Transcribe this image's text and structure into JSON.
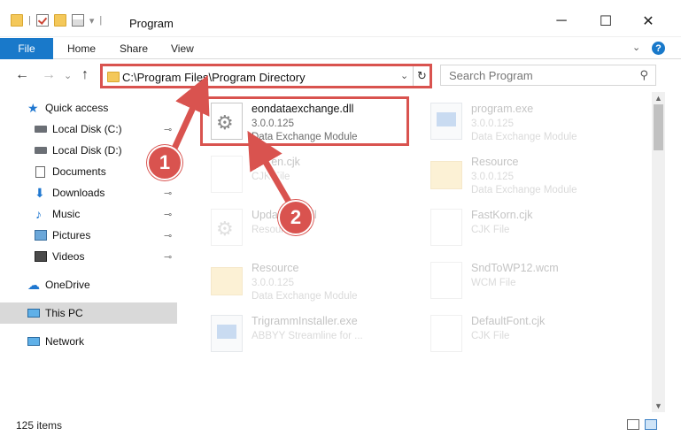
{
  "window": {
    "title": "Program",
    "minimize": "─",
    "maximize": "☐",
    "close": "✕"
  },
  "ribbon": {
    "file": "File",
    "home": "Home",
    "share": "Share",
    "view": "View",
    "collapse": "⌄",
    "help": "?"
  },
  "nav": {
    "back": "←",
    "forward": "→",
    "recent": "⌄",
    "up": "↑"
  },
  "address": {
    "path": "C:\\Program Files\\Program Directory",
    "dropdown": "⌄",
    "refresh": "↻"
  },
  "search": {
    "placeholder": "Search Program",
    "icon": "⚲"
  },
  "sidebar": {
    "items": [
      {
        "label": "Quick access",
        "icon": "star-icon",
        "pinned": false
      },
      {
        "label": "Local Disk (C:)",
        "icon": "disk-icon",
        "pinned": true
      },
      {
        "label": "Local Disk (D:)",
        "icon": "disk-icon",
        "pinned": true
      },
      {
        "label": "Documents",
        "icon": "document-icon",
        "pinned": true
      },
      {
        "label": "Downloads",
        "icon": "download-icon",
        "pinned": true
      },
      {
        "label": "Music",
        "icon": "music-icon",
        "pinned": true
      },
      {
        "label": "Pictures",
        "icon": "picture-icon",
        "pinned": true
      },
      {
        "label": "Videos",
        "icon": "video-icon",
        "pinned": true
      },
      {
        "label": "OneDrive",
        "icon": "cloud-icon",
        "pinned": false
      },
      {
        "label": "This PC",
        "icon": "pc-icon",
        "pinned": false,
        "selected": true
      },
      {
        "label": "Network",
        "icon": "network-icon",
        "pinned": false
      }
    ],
    "pin_glyph": "📌"
  },
  "files": [
    {
      "name": "eondataexchange.dll",
      "line1": "3.0.0.125",
      "line2": "Data Exchange Module",
      "icon": "gear-file-icon",
      "highlighted": true
    },
    {
      "name": "program.exe",
      "line1": "3.0.0.125",
      "line2": "Data Exchange Module",
      "icon": "exe-icon"
    },
    {
      "name": "Kr...en.cjk",
      "line1": "CJK File",
      "line2": "",
      "icon": "file-icon"
    },
    {
      "name": "Resource",
      "line1": "3.0.0.125",
      "line2": "Data Exchange Module",
      "icon": "folder-icon"
    },
    {
      "name": "Updat...19.dll",
      "line1": "Resour...",
      "line2": "",
      "icon": "gear-file-icon"
    },
    {
      "name": "FastKorn.cjk",
      "line1": "CJK File",
      "line2": "",
      "icon": "file-icon"
    },
    {
      "name": "Resource",
      "line1": "3.0.0.125",
      "line2": "Data Exchange Module",
      "icon": "folder-icon"
    },
    {
      "name": "SndToWP12.wcm",
      "line1": "WCM File",
      "line2": "",
      "icon": "file-icon"
    },
    {
      "name": "TrigrammInstaller.exe",
      "line1": "ABBYY Streamline for ...",
      "line2": "",
      "icon": "exe-icon"
    },
    {
      "name": "DefaultFont.cjk",
      "line1": "CJK File",
      "line2": "",
      "icon": "file-icon"
    }
  ],
  "annotations": {
    "step1": "1",
    "step2": "2",
    "color": "#d9534f"
  },
  "status": {
    "count": "125 items"
  }
}
